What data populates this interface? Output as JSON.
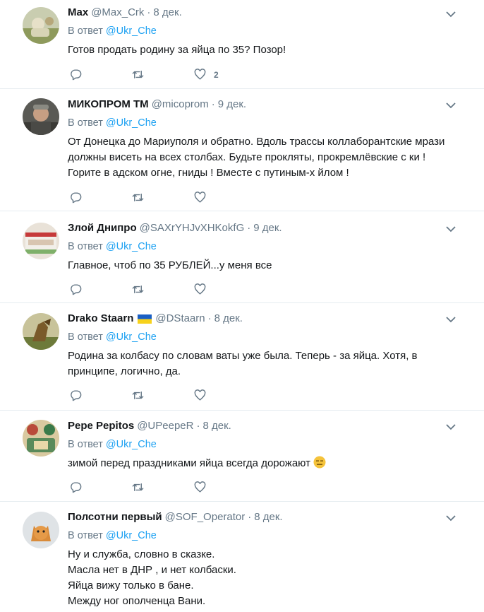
{
  "reply_prefix": "В ответ",
  "reply_mention": "@Ukr_Che",
  "tweets": [
    {
      "name": "Max",
      "handle": "@Max_Crk",
      "date": "8 дек.",
      "lines": [
        "Готов продать родину за яйца по 35? Позор!"
      ],
      "like_count": "2"
    },
    {
      "name": "МИКОПРОМ ТМ",
      "handle": "@micoprom",
      "date": "9 дек.",
      "lines": [
        "От Донецка до Мариуполя и обратно. Вдоль трассы коллаборантские мрази",
        "должны висеть на всех столбах. Будьте прокляты, прокремлёвские с  ки !",
        "Горите в адском огне, гниды ! Вместе с путиным-х  йлом !"
      ],
      "like_count": ""
    },
    {
      "name": "Злой Днипро",
      "handle": "@SAXrYHJvXHKokfG",
      "date": "9 дек.",
      "lines": [
        "Главное, чтоб по 35 РУБЛЕЙ...у меня все"
      ],
      "like_count": ""
    },
    {
      "name": "Drako Staarn",
      "handle": "@DStaarn",
      "date": "8 дек.",
      "lines": [
        "Родина за колбасу по словам ваты уже была. Теперь - за яйца. Хотя, в",
        "принципе, логично, да."
      ],
      "like_count": ""
    },
    {
      "name": "Pepe Pepitos",
      "handle": "@UPeepeR",
      "date": "8 дек.",
      "lines": [
        "зимой перед праздниками яйца всегда дорожают"
      ],
      "like_count": ""
    },
    {
      "name": "Полсотни первый",
      "handle": "@SOF_Operator",
      "date": "8 дек.",
      "lines": [
        "Ну и служба, словно в сказке.",
        "Масла нет в ДНР , и нет колбаски.",
        "Яйца вижу только в бане.",
        "Между ног ополченца Вани."
      ],
      "like_count": ""
    }
  ],
  "icons": {
    "reply": "reply-icon",
    "retweet": "retweet-icon",
    "like": "heart-icon",
    "more": "chevron-down-icon",
    "flag": "ukraine-flag-icon",
    "emoji": "expressionless-face-emoji"
  },
  "colors": {
    "link": "#1da1f2",
    "muted": "#657786",
    "text": "#14171a",
    "divider": "#e6ecf0"
  }
}
